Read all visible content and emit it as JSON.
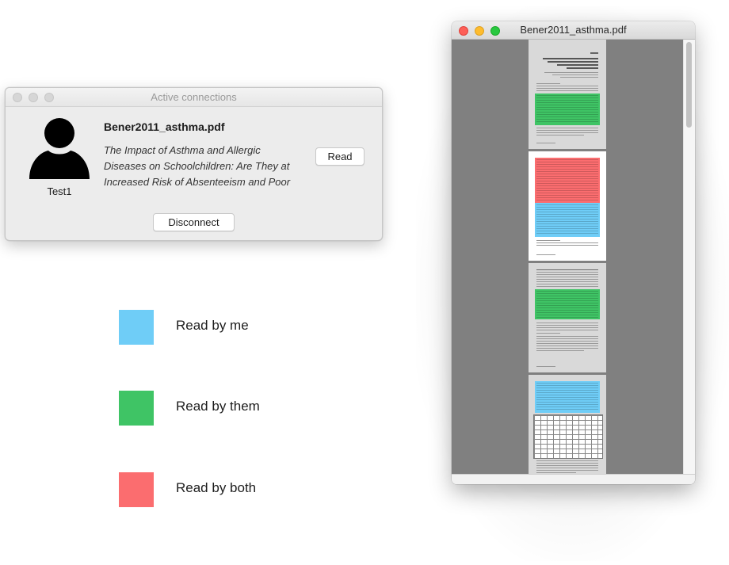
{
  "connections_window": {
    "title": "Active connections",
    "user": {
      "name": "Test1",
      "icon": "person-silhouette-icon"
    },
    "file_name": "Bener2011_asthma.pdf",
    "doc_title": "The Impact of Asthma and Allergic Diseases on Schoolchildren: Are They at Increased Risk of Absenteeism and Poor",
    "read_label": "Read",
    "disconnect_label": "Disconnect"
  },
  "legend": [
    {
      "label": "Read by me",
      "color": "#6fcdf7"
    },
    {
      "label": "Read by them",
      "color": "#3fc465"
    },
    {
      "label": "Read by both",
      "color": "#fb6d6f"
    }
  ],
  "pdf_window": {
    "title": "Bener2011_asthma.pdf",
    "pages": [
      {
        "page": 1,
        "highlights": [
          "green"
        ]
      },
      {
        "page": 2,
        "highlights": [
          "red",
          "blue"
        ]
      },
      {
        "page": 3,
        "highlights": [
          "green"
        ]
      },
      {
        "page": 4,
        "highlights": [
          "blue"
        ]
      }
    ]
  },
  "colors": {
    "read_by_me": "#6fcdf7",
    "read_by_them": "#3fc465",
    "read_by_both": "#fb6d6f"
  }
}
